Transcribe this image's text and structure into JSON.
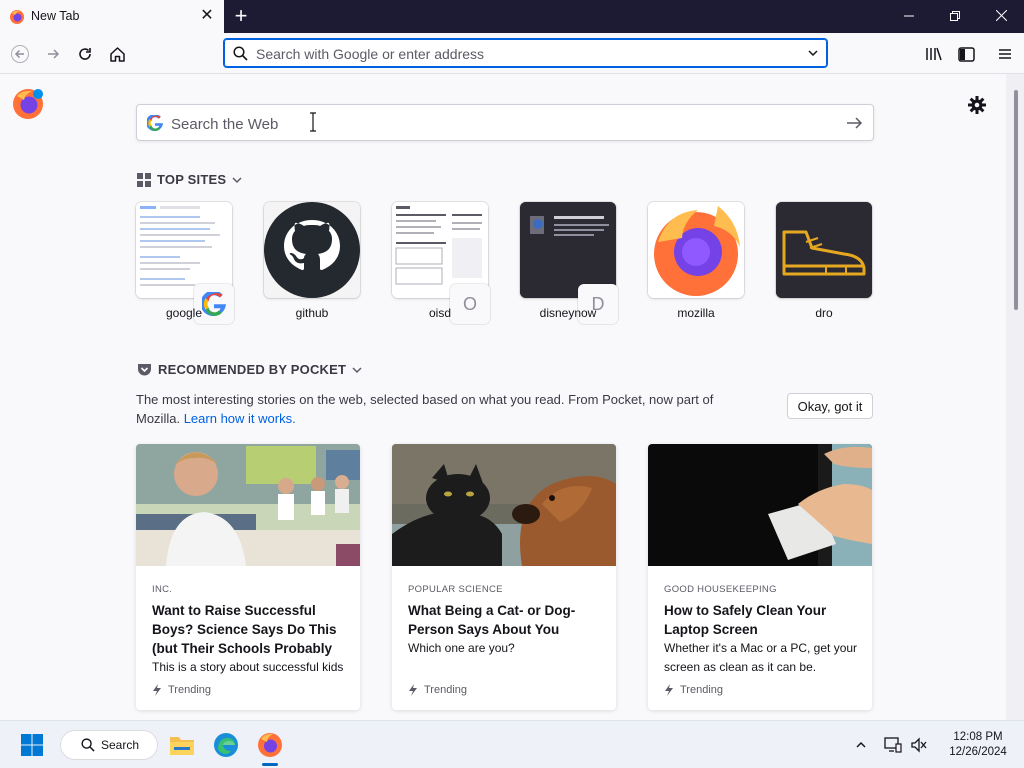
{
  "browser": {
    "tab": {
      "title": "New Tab"
    },
    "urlbar": {
      "placeholder": "Search with Google or enter address"
    }
  },
  "newtab": {
    "search": {
      "placeholder": "Search the Web"
    },
    "top_sites": {
      "heading": "TOP SITES",
      "sites": [
        {
          "name": "google",
          "badge": "G"
        },
        {
          "name": "github",
          "badge": ""
        },
        {
          "name": "oisd",
          "badge": "O"
        },
        {
          "name": "disneynow",
          "badge": "D"
        },
        {
          "name": "mozilla",
          "badge": ""
        },
        {
          "name": "dro",
          "badge": ""
        }
      ]
    },
    "pocket": {
      "heading": "RECOMMENDED BY POCKET",
      "description": "The most interesting stories on the web, selected based on what you read. From Pocket, now part of Mozilla.",
      "learn_link": "Learn how it works.",
      "okay_button": "Okay, got it",
      "cards": [
        {
          "source": "INC.",
          "title": "Want to Raise Successful Boys? Science Says Do This (but Their Schools Probably",
          "excerpt": "This is a story about successful kids",
          "trending": "Trending"
        },
        {
          "source": "POPULAR SCIENCE",
          "title": "What Being a Cat- or Dog-Person Says About You",
          "excerpt": "Which one are you?",
          "trending": "Trending"
        },
        {
          "source": "GOOD HOUSEKEEPING",
          "title": "How to Safely Clean Your Laptop Screen",
          "excerpt": "Whether it's a Mac or a PC, get your screen as clean as it can be.",
          "trending": "Trending"
        }
      ]
    }
  },
  "taskbar": {
    "search_label": "Search",
    "time": "12:08 PM",
    "date": "12/26/2024"
  },
  "colors": {
    "titlebar": "#1c1b33",
    "accent": "#0061e0",
    "page_bg": "#f9f9fb"
  },
  "icons": [
    "firefox-icon",
    "close-icon",
    "plus-icon",
    "minimize-icon",
    "maximize-icon",
    "back-arrow-icon",
    "forward-arrow-icon",
    "reload-icon",
    "home-icon",
    "search-icon",
    "chevron-down-icon",
    "library-icon",
    "sidebar-icon",
    "menu-icon",
    "gear-icon",
    "arrow-right-icon",
    "grid-icon",
    "pocket-icon",
    "lightning-icon",
    "windows-start-icon",
    "file-explorer-icon",
    "edge-icon",
    "chevron-up-icon",
    "network-icon",
    "volume-icon"
  ]
}
